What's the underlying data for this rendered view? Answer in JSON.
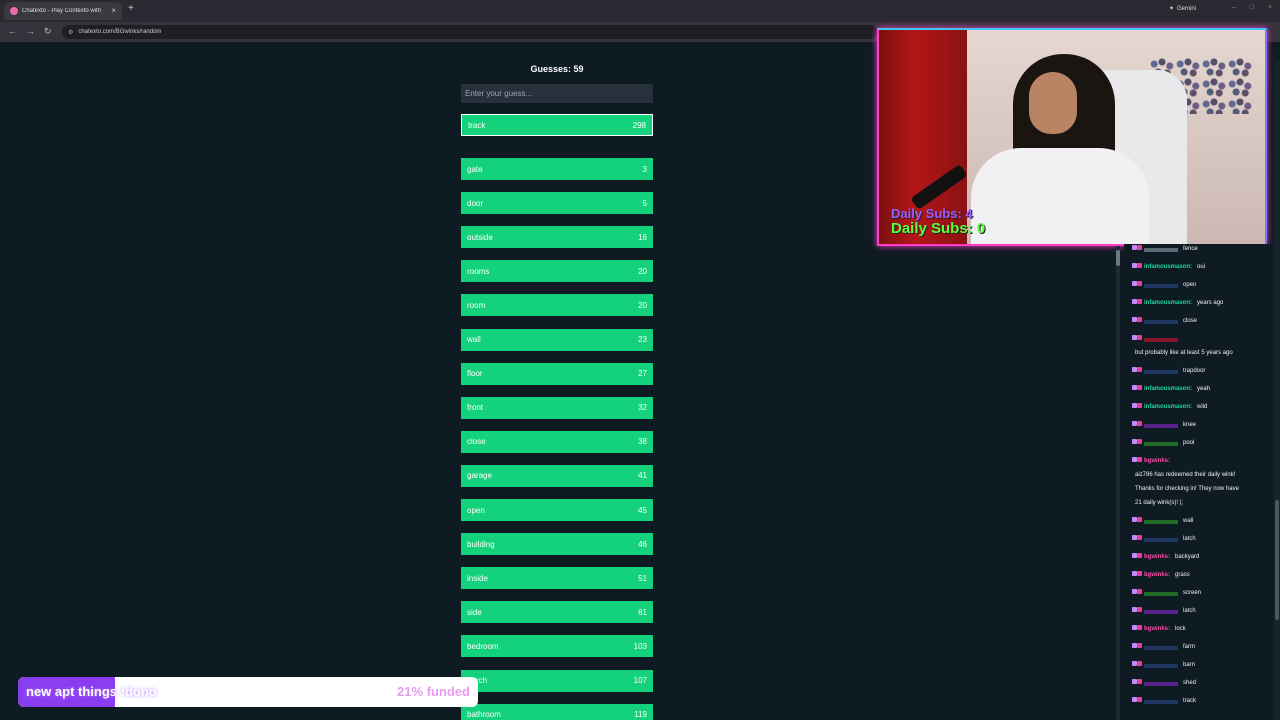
{
  "browser": {
    "tab_title": "Chatexto - Play Contexto with",
    "new_tab": "+",
    "gemini_label": "Gemini",
    "url": "chatexto.com/BGwinks/random",
    "window_controls": [
      "–",
      "□",
      "×"
    ]
  },
  "game": {
    "guesses_label": "Guesses: 59",
    "input_placeholder": "Enter your guess...",
    "current_guess": {
      "word": "track",
      "rank": "298"
    },
    "rows": [
      {
        "word": "gate",
        "rank": "3"
      },
      {
        "word": "door",
        "rank": "5"
      },
      {
        "word": "outside",
        "rank": "16"
      },
      {
        "word": "rooms",
        "rank": "20"
      },
      {
        "word": "room",
        "rank": "20"
      },
      {
        "word": "wall",
        "rank": "23"
      },
      {
        "word": "floor",
        "rank": "27"
      },
      {
        "word": "front",
        "rank": "32"
      },
      {
        "word": "close",
        "rank": "38"
      },
      {
        "word": "garage",
        "rank": "41"
      },
      {
        "word": "open",
        "rank": "45"
      },
      {
        "word": "building",
        "rank": "46"
      },
      {
        "word": "inside",
        "rank": "51"
      },
      {
        "word": "side",
        "rank": "61"
      },
      {
        "word": "bedroom",
        "rank": "103"
      },
      {
        "word": "porch",
        "rank": "107"
      },
      {
        "word": "bathroom",
        "rank": "119"
      }
    ]
  },
  "overlay": {
    "daily_subs_1": "Daily Subs: 4",
    "daily_subs_2": "Daily Subs: 0"
  },
  "chat": {
    "messages": [
      {
        "user": "",
        "text": "fence",
        "color": "#8fa0b0"
      },
      {
        "user": "infamousmason:",
        "text": "oui",
        "color": "#22d3a6"
      },
      {
        "user": "",
        "text": "open",
        "color": "#2a4a8a"
      },
      {
        "user": "infamousmason:",
        "text": "years ago",
        "color": "#22d3a6"
      },
      {
        "user": "",
        "text": "close",
        "color": "#2a4a8a"
      },
      {
        "user": "",
        "text": "",
        "color": "#d01030"
      },
      {
        "user": "",
        "text": "but probably like at least 5 years ago",
        "color": "#f0f0f0"
      },
      {
        "user": "",
        "text": "trapdoor",
        "color": "#2a4a8a"
      },
      {
        "user": "infamousmason:",
        "text": "yeah",
        "color": "#22d3a6"
      },
      {
        "user": "infamousmason:",
        "text": "wild",
        "color": "#22d3a6"
      },
      {
        "user": "",
        "text": "knee",
        "color": "#8a2ad0"
      },
      {
        "user": "",
        "text": "pool",
        "color": "#28a028"
      },
      {
        "user": "bgwinks:",
        "text": "",
        "color": "#ff4da6"
      },
      {
        "user": "",
        "text": "aiz786 has redeemed their daily wink!",
        "color": "#f0f0f0"
      },
      {
        "user": "",
        "text": "Thanks for checking in! They now have",
        "color": "#f0f0f0"
      },
      {
        "user": "",
        "text": "21 daily wink(s)! (;",
        "color": "#f0f0f0"
      },
      {
        "user": "",
        "text": "wall",
        "color": "#28a028"
      },
      {
        "user": "",
        "text": "latch",
        "color": "#2a4a8a"
      },
      {
        "user": "bgwinks:",
        "text": "backyard",
        "color": "#ff4da6"
      },
      {
        "user": "bgwinks:",
        "text": "grass",
        "color": "#ff4da6"
      },
      {
        "user": "",
        "text": "screen",
        "color": "#28a028"
      },
      {
        "user": "",
        "text": "latch",
        "color": "#8a2ad0"
      },
      {
        "user": "bgwinks:",
        "text": "lock",
        "color": "#ff4da6"
      },
      {
        "user": "",
        "text": "farm",
        "color": "#2a4a8a"
      },
      {
        "user": "",
        "text": "barn",
        "color": "#2a4a8a"
      },
      {
        "user": "",
        "text": "shed",
        "color": "#8a2ad0"
      },
      {
        "user": "",
        "text": "track",
        "color": "#2a4a8a"
      }
    ]
  },
  "donation": {
    "goal_text": "new apt things !dono",
    "funded_text": "21% funded",
    "funded_fraction": 0.21
  },
  "colors": {
    "row_green": "#14d27b",
    "background": "#0f1b23",
    "overlay_border": "#ff3ec8"
  }
}
